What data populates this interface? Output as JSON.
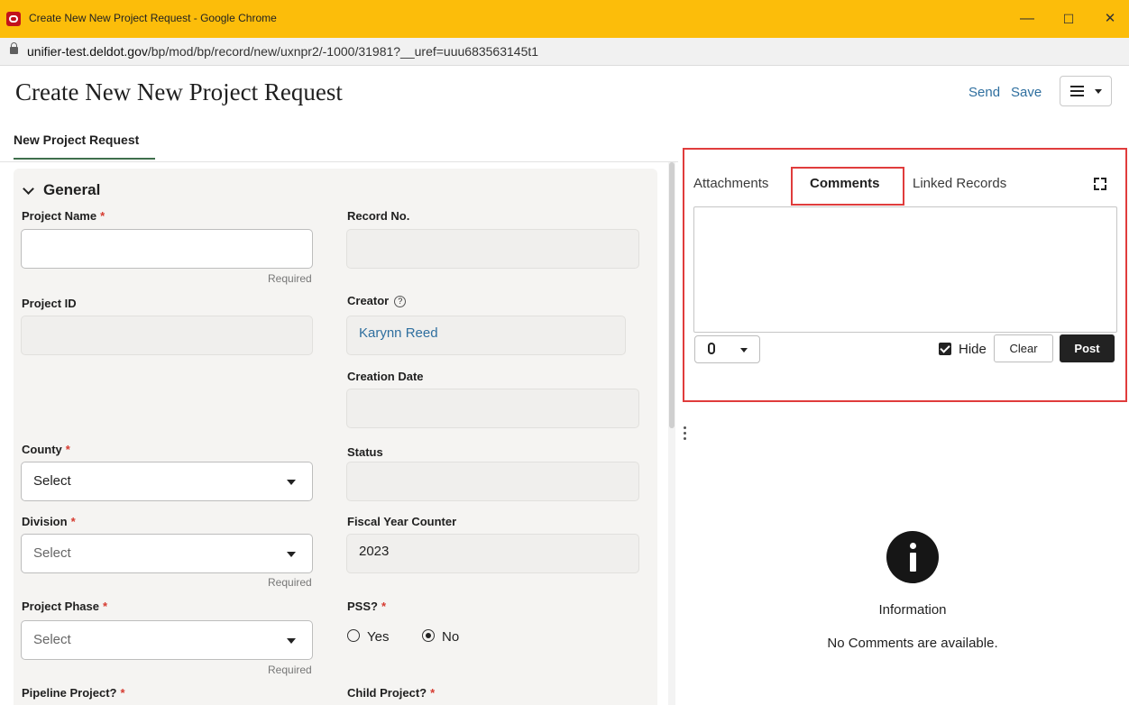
{
  "window": {
    "title": "Create New New Project Request - Google Chrome",
    "url_host": "unifier-test.deldot.gov",
    "url_path": "/bp/mod/bp/record/new/uxnpr2/-1000/31981?__uref=uuu683563145t1",
    "minimize": "—",
    "maximize": "☐",
    "close": "✕"
  },
  "header": {
    "title": "Create New New Project Request",
    "send_label": "Send",
    "save_label": "Save"
  },
  "form_tab": {
    "label": "New Project Request"
  },
  "general": {
    "section_title": "General",
    "project_name": {
      "label": "Project Name",
      "required_mark": "*",
      "value": "",
      "hint": "Required"
    },
    "record_no": {
      "label": "Record No.",
      "value": ""
    },
    "project_id": {
      "label": "Project ID",
      "value": ""
    },
    "creator": {
      "label": "Creator",
      "help": "?",
      "value": "Karynn Reed"
    },
    "creation_date": {
      "label": "Creation Date",
      "value": ""
    },
    "county": {
      "label": "County",
      "required_mark": "*",
      "value": "Select"
    },
    "status": {
      "label": "Status",
      "value": ""
    },
    "division": {
      "label": "Division",
      "required_mark": "*",
      "value": "Select",
      "hint": "Required"
    },
    "fiscal_year_counter": {
      "label": "Fiscal Year Counter",
      "value": "2023"
    },
    "project_phase": {
      "label": "Project Phase",
      "required_mark": "*",
      "value": "Select",
      "hint": "Required"
    },
    "pss": {
      "label": "PSS?",
      "required_mark": "*",
      "options": [
        "Yes",
        "No"
      ],
      "selected": "No"
    },
    "pipeline_project": {
      "label": "Pipeline Project?",
      "required_mark": "*"
    },
    "child_project": {
      "label": "Child Project?",
      "required_mark": "*"
    }
  },
  "side_panel": {
    "tabs": [
      "Attachments",
      "Comments",
      "Linked Records"
    ],
    "active_tab": "Comments",
    "comment_text": "",
    "hide_label": "Hide",
    "hide_checked": true,
    "clear_label": "Clear",
    "post_label": "Post",
    "info_title": "Information",
    "info_message": "No Comments are available."
  },
  "colors": {
    "title_bar": "#fcbd0a",
    "link": "#2f6f9f",
    "active_tab_underline": "#3f6f4c",
    "highlight_box": "#e03c3c",
    "required_star": "#d63b30"
  }
}
